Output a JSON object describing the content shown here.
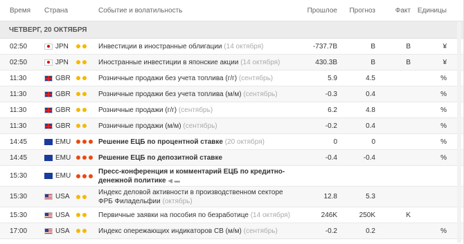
{
  "headers": {
    "time": "Время",
    "country": "Страна",
    "event": "Событие  и волатильность",
    "previous": "Прошлое",
    "forecast": "Прогноз",
    "actual": "Факт",
    "units": "Единицы"
  },
  "day_label": "ЧЕТВЕРГ, 20 ОКТЯБРЯ",
  "colors": {
    "yellow": "#f5b800",
    "red": "#e94a0e"
  },
  "rows": [
    {
      "time": "02:50",
      "country": "JPN",
      "flag": "jp",
      "dots": 2,
      "event": "Инвестиции в иностранные облигации",
      "date": "(14 октября)",
      "previous": "-737.7B",
      "forecast": "B",
      "actual": "B",
      "unit": "¥"
    },
    {
      "time": "02:50",
      "country": "JPN",
      "flag": "jp",
      "dots": 2,
      "event": "Иностранные инвестиции в японские акции",
      "date": "(14 октября)",
      "previous": "430.3B",
      "forecast": "B",
      "actual": "B",
      "unit": "¥"
    },
    {
      "time": "11:30",
      "country": "GBR",
      "flag": "gb",
      "dots": 2,
      "event": "Розничные продажи без учета топлива (г/г)",
      "date": "(сентябрь)",
      "previous": "5.9",
      "forecast": "4.5",
      "actual": "",
      "unit": "%"
    },
    {
      "time": "11:30",
      "country": "GBR",
      "flag": "gb",
      "dots": 2,
      "event": "Розничные продажи без учета топлива (м/м)",
      "date": "(сентябрь)",
      "previous": "-0.3",
      "forecast": "0.4",
      "actual": "",
      "unit": "%"
    },
    {
      "time": "11:30",
      "country": "GBR",
      "flag": "gb",
      "dots": 2,
      "event": "Розничные продажи (г/г)",
      "date": "(сентябрь)",
      "previous": "6.2",
      "forecast": "4.8",
      "actual": "",
      "unit": "%"
    },
    {
      "time": "11:30",
      "country": "GBR",
      "flag": "gb",
      "dots": 2,
      "event": "Розничные продажи (м/м)",
      "date": "(сентябрь)",
      "previous": "-0.2",
      "forecast": "0.4",
      "actual": "",
      "unit": "%"
    },
    {
      "time": "14:45",
      "country": "EMU",
      "flag": "eu",
      "dots": 3,
      "event": "Решение ЕЦБ по процентной ставке",
      "date": "(20 октября)",
      "previous": "0",
      "forecast": "0",
      "actual": "",
      "unit": "%",
      "bold": true
    },
    {
      "time": "14:45",
      "country": "EMU",
      "flag": "eu",
      "dots": 3,
      "event": "Решение ЕЦБ по депозитной ставке",
      "date": "",
      "previous": "-0.4",
      "forecast": "-0.4",
      "actual": "",
      "unit": "%",
      "bold": true
    },
    {
      "time": "15:30",
      "country": "EMU",
      "flag": "eu",
      "dots": 3,
      "event": "Пресс-конференция и комментарий ЕЦБ по кредитно-денежной политике",
      "date": "",
      "previous": "",
      "forecast": "",
      "actual": "",
      "unit": "",
      "bold": true,
      "icons": true
    },
    {
      "time": "15:30",
      "country": "USA",
      "flag": "us",
      "dots": 2,
      "event": "Индекс деловой активности в производственном секторе ФРБ Филадельфии",
      "date": "(октябрь)",
      "previous": "12.8",
      "forecast": "5.3",
      "actual": "",
      "unit": ""
    },
    {
      "time": "15:30",
      "country": "USA",
      "flag": "us",
      "dots": 2,
      "event": "Первичные заявки на пособия по безработице",
      "date": "(14 октября)",
      "previous": "246K",
      "forecast": "250K",
      "actual": "K",
      "unit": ""
    },
    {
      "time": "17:00",
      "country": "USA",
      "flag": "us",
      "dots": 2,
      "event": "Индекс опережающих индикаторов СВ (м/м)",
      "date": "(сентябрь)",
      "previous": "-0.2",
      "forecast": "0.2",
      "actual": "",
      "unit": "%"
    }
  ]
}
